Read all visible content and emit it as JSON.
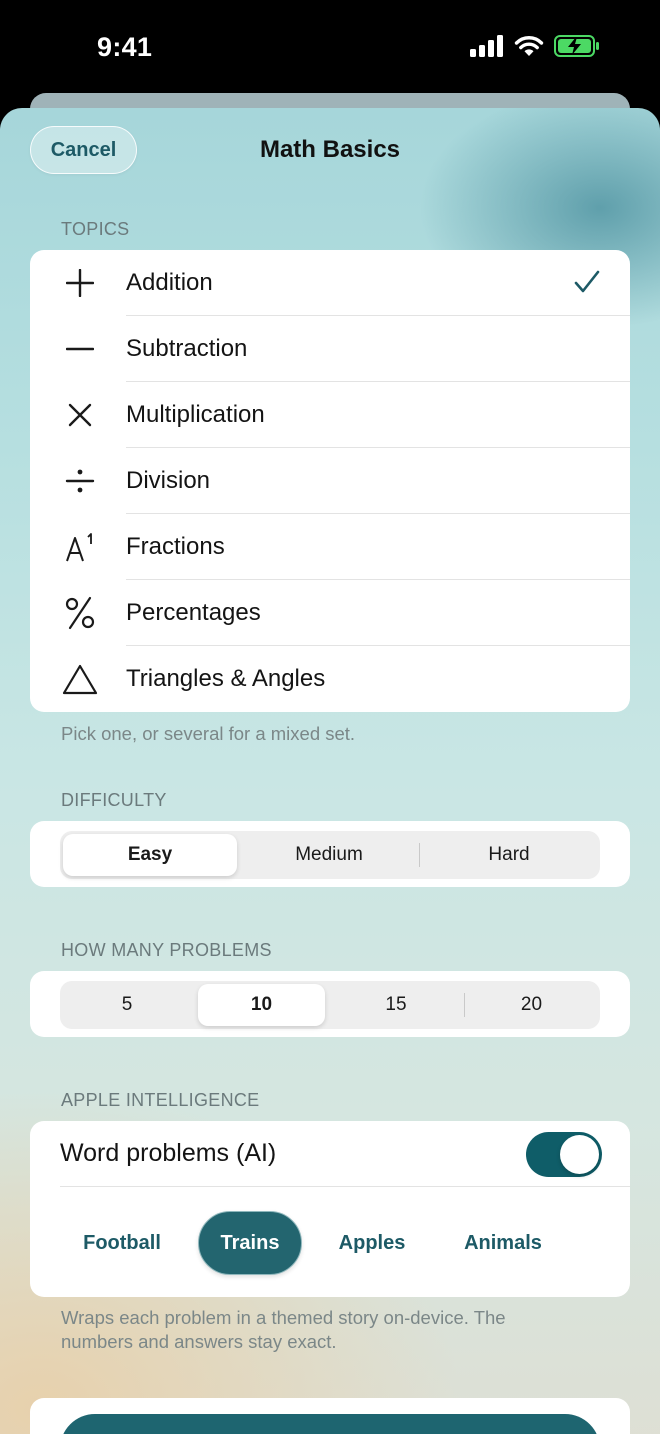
{
  "status_bar": {
    "time": "9:41"
  },
  "header": {
    "cancel_label": "Cancel",
    "title": "Math Basics"
  },
  "topics": {
    "label": "TOPICS",
    "items": [
      {
        "label": "Addition",
        "icon": "plus-icon",
        "selected": true
      },
      {
        "label": "Subtraction",
        "icon": "minus-icon",
        "selected": false
      },
      {
        "label": "Multiplication",
        "icon": "multiply-icon",
        "selected": false
      },
      {
        "label": "Division",
        "icon": "divide-icon",
        "selected": false
      },
      {
        "label": "Fractions",
        "icon": "superscript-icon",
        "superscript": "1",
        "selected": false
      },
      {
        "label": "Percentages",
        "icon": "percent-icon",
        "selected": false
      },
      {
        "label": "Triangles & Angles",
        "icon": "triangle-icon",
        "selected": false
      }
    ],
    "footer": "Pick one, or several for a mixed set."
  },
  "difficulty": {
    "label": "DIFFICULTY",
    "options": [
      "Easy",
      "Medium",
      "Hard"
    ],
    "selected": "Easy"
  },
  "problem_count": {
    "label": "HOW MANY PROBLEMS",
    "options": [
      "5",
      "10",
      "15",
      "20"
    ],
    "selected": "10"
  },
  "ai": {
    "label": "APPLE INTELLIGENCE",
    "toggle_label": "Word problems (AI)",
    "toggle_on": true,
    "themes": [
      "Football",
      "Trains",
      "Apples",
      "Animals"
    ],
    "selected_theme": "Trains",
    "footer_line1": "Wraps each problem in a themed story on-device. The",
    "footer_line2": "numbers and answers stay exact."
  },
  "colors": {
    "accent": "#1d5a66",
    "toggle_on": "#0f5d68",
    "chip_selected": "#23656f",
    "battery": "#4cd964"
  }
}
